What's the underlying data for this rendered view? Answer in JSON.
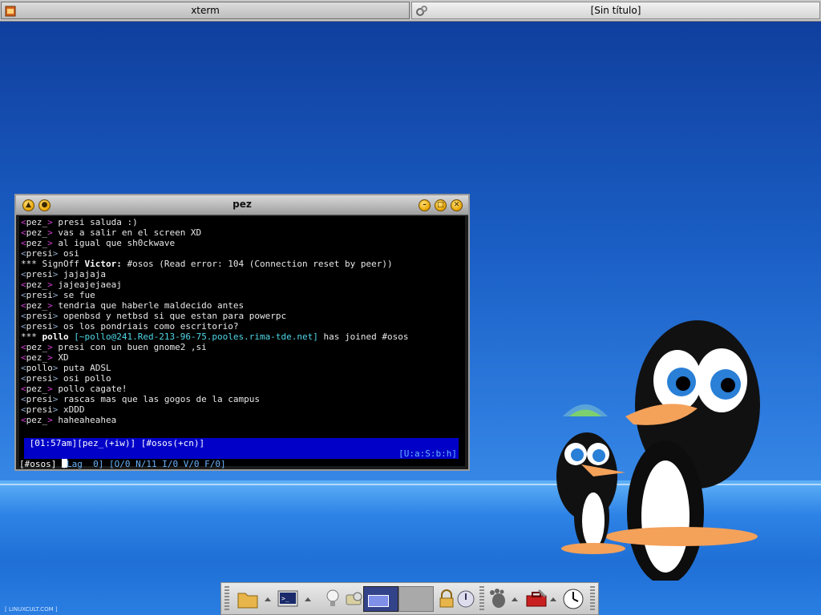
{
  "taskbar": {
    "tasks": [
      {
        "label": "xterm",
        "icon": "terminal-icon"
      },
      {
        "label": "[Sin título]",
        "icon": "gears-icon"
      }
    ]
  },
  "window": {
    "title": "pez",
    "buttons": [
      "shade-up",
      "minimize-left",
      "minimize",
      "maximize",
      "close"
    ]
  },
  "terminal": {
    "lines": [
      {
        "nick": "pez_",
        "kind": "pez",
        "text": " presi saluda :)"
      },
      {
        "nick": "pez_",
        "kind": "pez",
        "text": " vas a salir en el screen XD"
      },
      {
        "nick": "pez_",
        "kind": "pez",
        "text": " al igual que sh0ckwave"
      },
      {
        "nick": "presi",
        "kind": "presi",
        "text": " osi"
      },
      {
        "kind": "signoff",
        "pre": "*** SignOff ",
        "who": "Victor:",
        "text": " #osos (Read error: 104 (Connection reset by peer))"
      },
      {
        "nick": "presi",
        "kind": "presi",
        "text": " jajajaja"
      },
      {
        "nick": "pez_",
        "kind": "pez",
        "text": " jajeajejaeaj"
      },
      {
        "nick": "presi",
        "kind": "presi",
        "text": " se fue"
      },
      {
        "nick": "pez_",
        "kind": "pez",
        "text": " tendria que haberle maldecido antes"
      },
      {
        "nick": "presi",
        "kind": "presi",
        "text": " openbsd y netbsd si que estan para powerpc"
      },
      {
        "nick": "presi",
        "kind": "presi",
        "text": " os los pondriais como escritorio?"
      },
      {
        "kind": "join",
        "pre": "*** ",
        "who": "pollo",
        "host": " [~pollo@241.Red-213-96-75.pooles.rima-tde.net]",
        "text": " has joined #osos"
      },
      {
        "nick": "pez_",
        "kind": "pez",
        "text": " presi con un buen gnome2 ,si"
      },
      {
        "nick": "pez_",
        "kind": "pez",
        "text": " XD"
      },
      {
        "nick": "pollo",
        "kind": "presi",
        "text": " puta ADSL"
      },
      {
        "nick": "presi",
        "kind": "presi",
        "text": " osi pollo"
      },
      {
        "nick": "pez_",
        "kind": "pez",
        "text": " pollo cagate!"
      },
      {
        "nick": "presi",
        "kind": "presi",
        "text": " rascas mas que las gogos de la campus"
      },
      {
        "nick": "presi",
        "kind": "presi",
        "text": " xDDD"
      },
      {
        "nick": "pez_",
        "kind": "pez",
        "text": " haheaheahea"
      }
    ],
    "status_line_1": " [01:57am][pez_(+iw)] [#osos(+cn)]",
    "status_line_2": " [Lag  0] [O/0 N/11 I/0 V/0 F/0]",
    "status_line_2_right": "[U:a:S:b:h]",
    "input_prompt": "[#osos] "
  },
  "panel": {
    "items": [
      {
        "name": "file-manager-icon"
      },
      {
        "name": "terminal-launcher-icon"
      },
      {
        "name": "lightbulb-icon"
      },
      {
        "name": "run-icon"
      },
      {
        "name": "workspace-1"
      },
      {
        "name": "workspace-2"
      },
      {
        "name": "lock-icon"
      },
      {
        "name": "logout-icon"
      },
      {
        "name": "gnome-foot-icon"
      },
      {
        "name": "toolbox-icon"
      },
      {
        "name": "clock-icon"
      }
    ]
  },
  "watermark": "[ LINUXCULT.COM ]",
  "colors": {
    "desktop": "#1a5ec4",
    "statusbar": "#0000c8",
    "nick_bracket_pez": "#d040d0",
    "host_cyan": "#4fd8e8"
  }
}
